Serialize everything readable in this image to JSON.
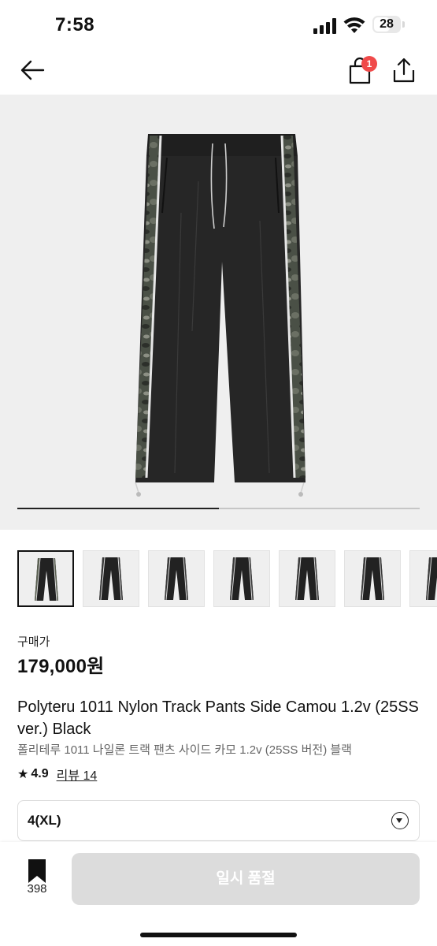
{
  "status_bar": {
    "time": "7:58",
    "battery": "28"
  },
  "nav": {
    "cart_badge": "1"
  },
  "gallery": {
    "progress": 0.5,
    "thumbnail_count": 7,
    "selected_index": 0
  },
  "product": {
    "price_label": "구매가",
    "price": "179,000원",
    "title_en": "Polyteru 1011 Nylon Track Pants Side Camou 1.2v (25SS ver.) Black",
    "title_ko": "폴리테루 1011 나일론 트랙 팬츠 사이드 카모 1.2v (25SS 버전) 블랙",
    "rating": "4.9",
    "review_label": "리뷰 14"
  },
  "size_select": {
    "value": "4(XL)"
  },
  "bottom_bar": {
    "bookmark_count": "398",
    "cta_label": "일시 품절"
  },
  "colors": {
    "badge": "#f04a4a",
    "cta_disabled": "#dcdcdc",
    "hero_bg": "#efefef"
  }
}
